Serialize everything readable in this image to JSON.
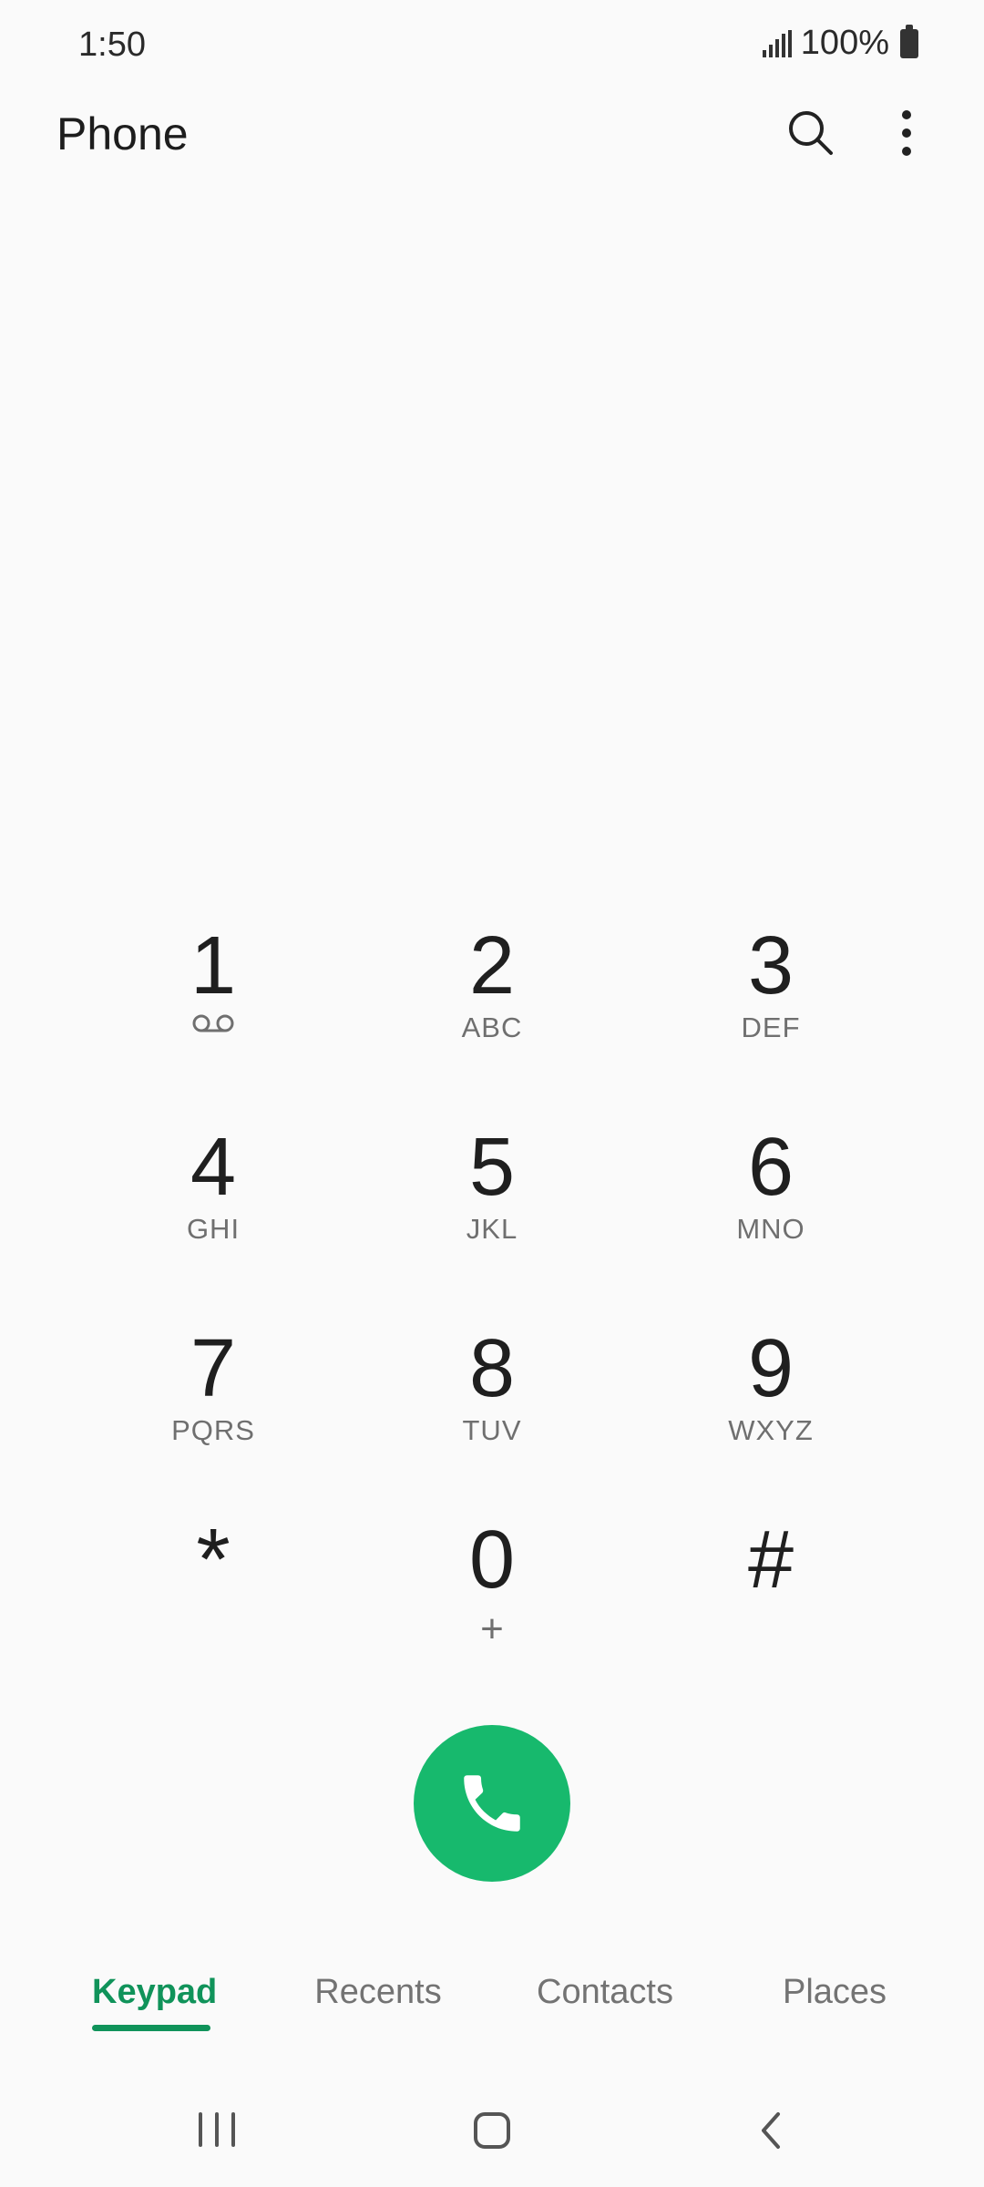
{
  "status_bar": {
    "time": "1:50",
    "battery": "100%"
  },
  "app_bar": {
    "title": "Phone",
    "search_icon": "search-icon",
    "more_icon": "more-vertical-icon"
  },
  "keypad": {
    "keys": [
      {
        "digit": "1",
        "sub": "",
        "sub_icon": "voicemail-icon"
      },
      {
        "digit": "2",
        "sub": "ABC"
      },
      {
        "digit": "3",
        "sub": "DEF"
      },
      {
        "digit": "4",
        "sub": "GHI"
      },
      {
        "digit": "5",
        "sub": "JKL"
      },
      {
        "digit": "6",
        "sub": "MNO"
      },
      {
        "digit": "7",
        "sub": "PQRS"
      },
      {
        "digit": "8",
        "sub": "TUV"
      },
      {
        "digit": "9",
        "sub": "WXYZ"
      },
      {
        "digit": "*",
        "sub": ""
      },
      {
        "digit": "0",
        "sub": "+"
      },
      {
        "digit": "#",
        "sub": ""
      }
    ]
  },
  "call_button": {
    "icon": "phone-icon",
    "color": "#17b96d"
  },
  "tabs": [
    {
      "label": "Keypad",
      "active": true
    },
    {
      "label": "Recents",
      "active": false
    },
    {
      "label": "Contacts",
      "active": false
    },
    {
      "label": "Places",
      "active": false
    }
  ],
  "accent_color": "#10935a",
  "nav_bar": {
    "recent_icon": "recent-apps-icon",
    "home_icon": "home-icon",
    "back_icon": "back-icon"
  }
}
